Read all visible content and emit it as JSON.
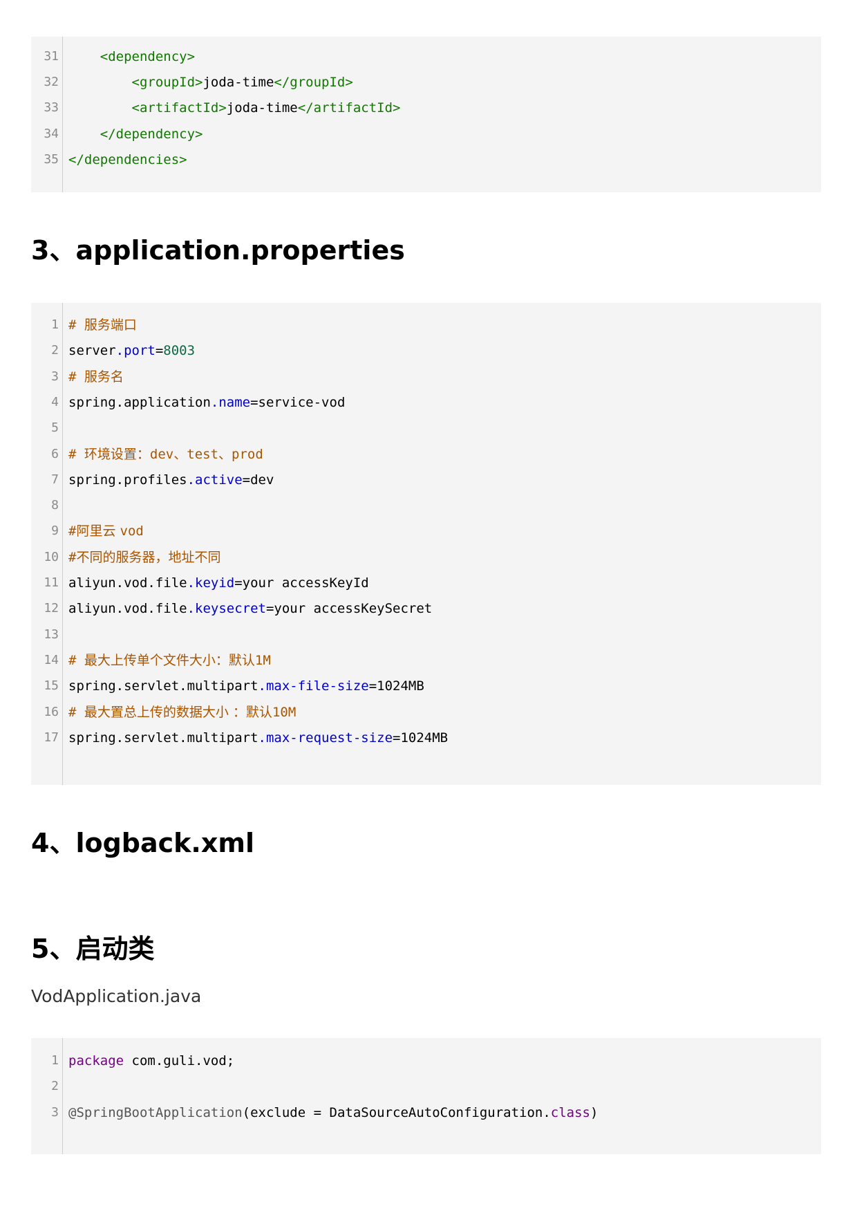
{
  "block1": {
    "lines": [
      {
        "n": "31",
        "tokens": [
          {
            "t": "    ",
            "c": "t-text"
          },
          {
            "t": "<dependency>",
            "c": "t-tag"
          }
        ]
      },
      {
        "n": "32",
        "tokens": [
          {
            "t": "        ",
            "c": "t-text"
          },
          {
            "t": "<groupId>",
            "c": "t-tag"
          },
          {
            "t": "joda-time",
            "c": "t-text"
          },
          {
            "t": "</groupId>",
            "c": "t-tag"
          }
        ]
      },
      {
        "n": "33",
        "tokens": [
          {
            "t": "        ",
            "c": "t-text"
          },
          {
            "t": "<artifactId>",
            "c": "t-tag"
          },
          {
            "t": "joda-time",
            "c": "t-text"
          },
          {
            "t": "</artifactId>",
            "c": "t-tag"
          }
        ]
      },
      {
        "n": "34",
        "tokens": [
          {
            "t": "    ",
            "c": "t-text"
          },
          {
            "t": "</dependency>",
            "c": "t-tag"
          }
        ]
      },
      {
        "n": "35",
        "tokens": [
          {
            "t": "</dependencies>",
            "c": "t-tag"
          }
        ]
      }
    ]
  },
  "heading3": "3、application.properties",
  "block2": {
    "lines": [
      {
        "n": "1",
        "tokens": [
          {
            "t": "# ",
            "c": "t-comment"
          },
          {
            "t": "服务端口",
            "c": "t-comment t-cjk"
          }
        ]
      },
      {
        "n": "2",
        "tokens": [
          {
            "t": "server",
            "c": "t-key"
          },
          {
            "t": ".port",
            "c": "t-dot"
          },
          {
            "t": "=",
            "c": "t-text"
          },
          {
            "t": "8003",
            "c": "t-num"
          }
        ]
      },
      {
        "n": "3",
        "tokens": [
          {
            "t": "# ",
            "c": "t-comment"
          },
          {
            "t": "服务名",
            "c": "t-comment t-cjk"
          }
        ]
      },
      {
        "n": "4",
        "tokens": [
          {
            "t": "spring.application",
            "c": "t-key"
          },
          {
            "t": ".name",
            "c": "t-dot"
          },
          {
            "t": "=service-vod",
            "c": "t-text"
          }
        ]
      },
      {
        "n": "5",
        "tokens": []
      },
      {
        "n": "6",
        "tokens": [
          {
            "t": "# ",
            "c": "t-comment"
          },
          {
            "t": "环境设置：",
            "c": "t-comment t-cjk"
          },
          {
            "t": "dev",
            "c": "t-comment"
          },
          {
            "t": "、",
            "c": "t-comment t-cjk"
          },
          {
            "t": "test",
            "c": "t-comment"
          },
          {
            "t": "、",
            "c": "t-comment t-cjk"
          },
          {
            "t": "prod",
            "c": "t-comment"
          }
        ]
      },
      {
        "n": "7",
        "tokens": [
          {
            "t": "spring.profiles",
            "c": "t-key"
          },
          {
            "t": ".active",
            "c": "t-dot"
          },
          {
            "t": "=dev",
            "c": "t-text"
          }
        ]
      },
      {
        "n": "8",
        "tokens": []
      },
      {
        "n": "9",
        "tokens": [
          {
            "t": "#",
            "c": "t-comment"
          },
          {
            "t": "阿里云 ",
            "c": "t-comment t-cjk"
          },
          {
            "t": "vod",
            "c": "t-comment"
          }
        ]
      },
      {
        "n": "10",
        "tokens": [
          {
            "t": "#",
            "c": "t-comment"
          },
          {
            "t": "不同的服务器，地址不同",
            "c": "t-comment t-cjk"
          }
        ]
      },
      {
        "n": "11",
        "tokens": [
          {
            "t": "aliyun.vod.file",
            "c": "t-key"
          },
          {
            "t": ".keyid",
            "c": "t-dot"
          },
          {
            "t": "=your accessKeyId",
            "c": "t-text"
          }
        ]
      },
      {
        "n": "12",
        "tokens": [
          {
            "t": "aliyun.vod.file",
            "c": "t-key"
          },
          {
            "t": ".keysecret",
            "c": "t-dot"
          },
          {
            "t": "=your accessKeySecret",
            "c": "t-text"
          }
        ]
      },
      {
        "n": "13",
        "tokens": []
      },
      {
        "n": "14",
        "tokens": [
          {
            "t": "# ",
            "c": "t-comment"
          },
          {
            "t": "最大上传单个文件大小：默认",
            "c": "t-comment t-cjk"
          },
          {
            "t": "1M",
            "c": "t-comment"
          }
        ]
      },
      {
        "n": "15",
        "tokens": [
          {
            "t": "spring.servlet.multipart",
            "c": "t-key"
          },
          {
            "t": ".max-file-size",
            "c": "t-dot"
          },
          {
            "t": "=1024MB",
            "c": "t-text"
          }
        ]
      },
      {
        "n": "16",
        "tokens": [
          {
            "t": "# ",
            "c": "t-comment"
          },
          {
            "t": "最大置总上传的数据大小 ：默认",
            "c": "t-comment t-cjk"
          },
          {
            "t": "10M",
            "c": "t-comment"
          }
        ]
      },
      {
        "n": "17",
        "tokens": [
          {
            "t": "spring.servlet.multipart",
            "c": "t-key"
          },
          {
            "t": ".max-request-size",
            "c": "t-dot"
          },
          {
            "t": "=1024MB",
            "c": "t-text"
          }
        ]
      }
    ]
  },
  "heading4": "4、logback.xml",
  "heading5": "5、启动类",
  "caption": "VodApplication.java",
  "block3": {
    "lines": [
      {
        "n": "1",
        "tokens": [
          {
            "t": "package",
            "c": "t-kw"
          },
          {
            "t": " com.guli.vod;",
            "c": "t-text"
          }
        ]
      },
      {
        "n": "2",
        "tokens": []
      },
      {
        "n": "3",
        "tokens": [
          {
            "t": "@SpringBootApplication",
            "c": "t-meta"
          },
          {
            "t": "(exclude = DataSourceAutoConfiguration.",
            "c": "t-text"
          },
          {
            "t": "class",
            "c": "t-class"
          },
          {
            "t": ")",
            "c": "t-text"
          }
        ]
      }
    ]
  }
}
